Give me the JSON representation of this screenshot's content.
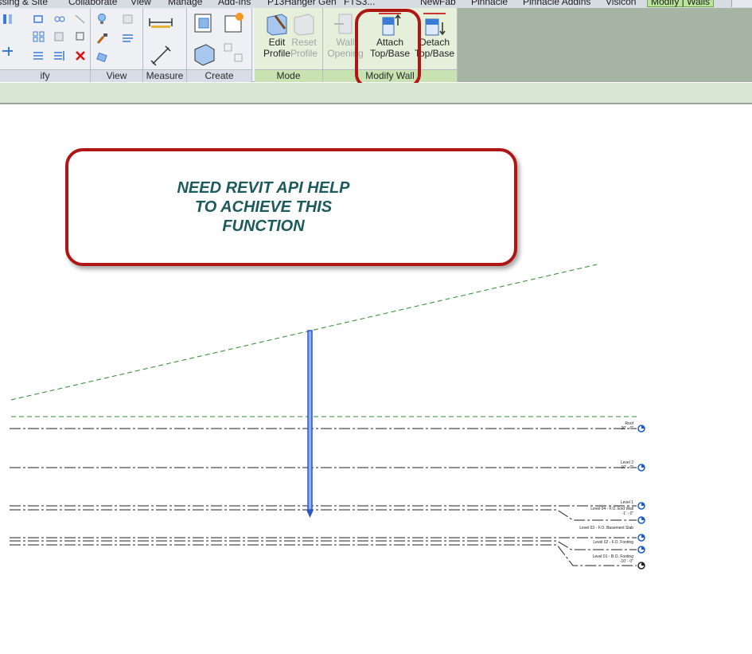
{
  "tabs": [
    {
      "label": "assing & Site",
      "active": false
    },
    {
      "label": "Collaborate",
      "active": false
    },
    {
      "label": "View",
      "active": false
    },
    {
      "label": "Manage",
      "active": false
    },
    {
      "label": "Add-Ins",
      "active": false
    },
    {
      "label": "P13Hanger Gen",
      "active": false
    },
    {
      "label": "FTS3...",
      "active": false
    },
    {
      "label": "NewFab",
      "active": false
    },
    {
      "label": "Pinnacle",
      "active": false
    },
    {
      "label": "Pinnacle Addins",
      "active": false
    },
    {
      "label": "Visicon",
      "active": false
    },
    {
      "label": "Modify | Walls",
      "active": true
    }
  ],
  "panels": {
    "modify": {
      "title": "ify"
    },
    "view": {
      "title": "View"
    },
    "measure": {
      "title": "Measure"
    },
    "create": {
      "title": "Create"
    },
    "mode": {
      "title": "Mode"
    },
    "modify_wall": {
      "title": "Modify Wall"
    }
  },
  "buttons": {
    "edit_profile": {
      "line1": "Edit",
      "line2": "Profile"
    },
    "reset_profile": {
      "line1": "Reset",
      "line2": "Profile"
    },
    "wall_opening": {
      "line1": "Wall",
      "line2": "Opening"
    },
    "attach_top_base": {
      "line1": "Attach",
      "line2": "Top/Base"
    },
    "detach_top_base": {
      "line1": "Detach",
      "line2": "Top/Base"
    }
  },
  "callout": {
    "line1": "NEED REVIT API HELP",
    "line2": "TO ACHIEVE THIS",
    "line3": "FUNCTION"
  },
  "levels": {
    "roof": {
      "name": "Roof",
      "elev": "20' - 0\""
    },
    "level2": {
      "name": "Level 2",
      "elev": "10' - 0\""
    },
    "level1": {
      "name": "Level 1",
      "elev": "0' - 0\""
    },
    "level04": {
      "name": "Level 04 - F.O. End Wall",
      "elev": "-1' - 0\""
    },
    "level03": {
      "name": "Level 03 - F.O. Basement Slab",
      "elev": ""
    },
    "level02": {
      "name": "Level 02 - F.O. Footing",
      "elev": ""
    },
    "level01": {
      "name": "Level 01 - B.O. Footing",
      "elev": "-10' - 0\""
    }
  },
  "colors": {
    "callout_border": "#b01515",
    "callout_text": "#1d5a5e",
    "wall": "#2a56c6",
    "reference_plane": "#2e8b2e",
    "level_head": "#1f5bc4",
    "context_tab": "#b9e59a"
  }
}
